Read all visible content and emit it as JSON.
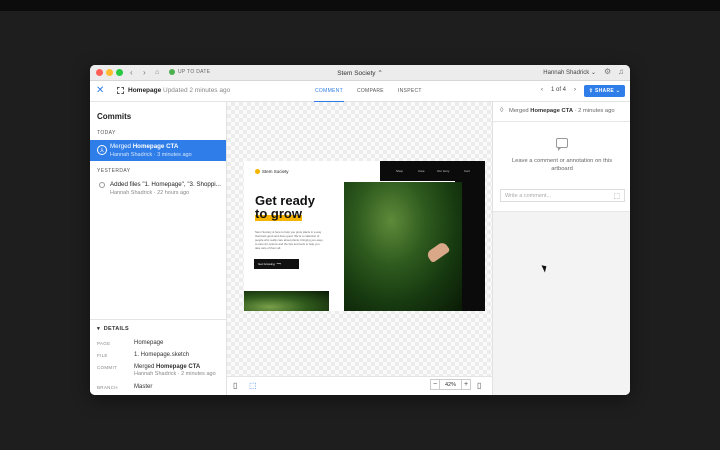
{
  "titlebar": {
    "status": "UP TO DATE",
    "project": "Stem Society",
    "user": "Hannah Shadrick"
  },
  "toolbar": {
    "page_title": "Homepage",
    "updated": "Updated 2 minutes ago",
    "tabs": [
      "COMMENT",
      "COMPARE",
      "INSPECT"
    ],
    "active_tab": "COMMENT",
    "pager": "1 of 4",
    "share": "SHARE"
  },
  "sidebar": {
    "title": "Commits",
    "today_label": "TODAY",
    "yesterday_label": "YESTERDAY",
    "commits": [
      {
        "prefix": "Merged",
        "bold": "Homepage CTA",
        "meta": "Hannah Shadrick · 3 minutes ago"
      },
      {
        "prefix": "Added files \"1. Homepage\", \"3. Shoppi...",
        "bold": "",
        "meta": "Hannah Shadrick · 22 hours ago"
      }
    ],
    "details": {
      "heading": "DETAILS",
      "page_key": "PAGE",
      "page_val": "Homepage",
      "file_key": "FILE",
      "file_val": "1. Homepage.sketch",
      "commit_key": "COMMIT",
      "commit_prefix": "Merged",
      "commit_bold": "Homepage CTA",
      "commit_meta": "Hannah Shadrick · 2 minutes ago",
      "branch_key": "BRANCH",
      "branch_val": "Master"
    }
  },
  "artboard": {
    "logo": "Stem Society",
    "nav": [
      "Shop",
      "Care",
      "Our story",
      "Cart"
    ],
    "headline_1": "Get ready",
    "headline_2": "to grow",
    "body": "Stem Society is here to help you grow plants in a way that feels good and does good. We're a collection of people who really care about plants, bringing you easy-to-care-for options and the tips and tools to help you take care of them all.",
    "cta": "Get Growing"
  },
  "canvas_footer": {
    "zoom": "42%",
    "minus": "−",
    "plus": "+"
  },
  "comments": {
    "prefix": "Merged",
    "bold": "Homepage CTA",
    "suffix": "· 2 minutes ago",
    "empty_text": "Leave a comment or annotation on this artboard",
    "input_placeholder": "Write a comment..."
  },
  "colors": {
    "accent": "#2e7de8",
    "highlight": "#f5b400"
  }
}
